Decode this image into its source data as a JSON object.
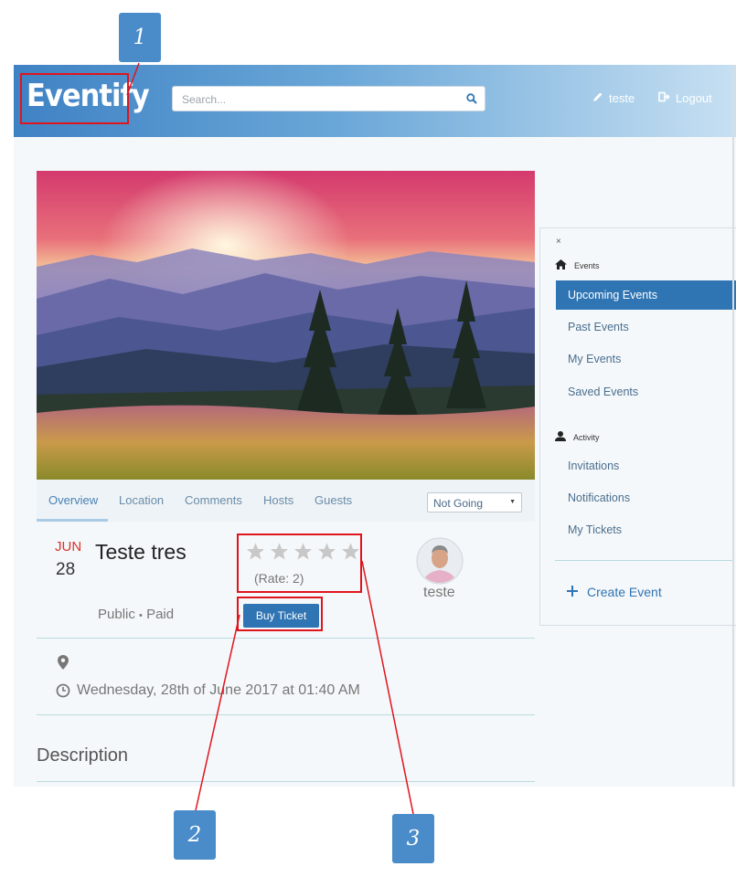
{
  "navbar": {
    "brand": "Eventify",
    "search_placeholder": "Search...",
    "user_link": "teste",
    "logout_link": "Logout"
  },
  "event_tabs": {
    "items": [
      {
        "label": "Overview",
        "active": true
      },
      {
        "label": "Location",
        "active": false
      },
      {
        "label": "Comments",
        "active": false
      },
      {
        "label": "Hosts",
        "active": false
      },
      {
        "label": "Guests",
        "active": false
      }
    ],
    "rsvp_selected": "Not Going"
  },
  "event": {
    "month": "JUN",
    "day": "28",
    "title": "Teste tres",
    "rating_stars_filled": 0,
    "rating_stars_total": 5,
    "rate_label": "(Rate: 2)",
    "visibility": "Public",
    "separator": "•",
    "pricing": "Paid",
    "buy_label": "Buy Ticket",
    "host_name": "teste",
    "datetime": "Wednesday, 28th of June 2017 at 01:40 AM",
    "description_heading": "Description"
  },
  "sidebar": {
    "close": "×",
    "events_heading": "Events",
    "events_items": [
      {
        "label": "Upcoming Events",
        "active": true
      },
      {
        "label": "Past Events",
        "active": false
      },
      {
        "label": "My Events",
        "active": false
      },
      {
        "label": "Saved Events",
        "active": false
      }
    ],
    "activity_heading": "Activity",
    "activity_items": [
      {
        "label": "Invitations"
      },
      {
        "label": "Notifications"
      },
      {
        "label": "My Tickets"
      }
    ],
    "create_label": "Create Event"
  },
  "annotations": [
    "1",
    "2",
    "3"
  ],
  "colors": {
    "primary": "#2f74b3",
    "accent_red": "#e0141c",
    "callout_blue": "#4a8cc9",
    "date_red": "#d9322b"
  }
}
